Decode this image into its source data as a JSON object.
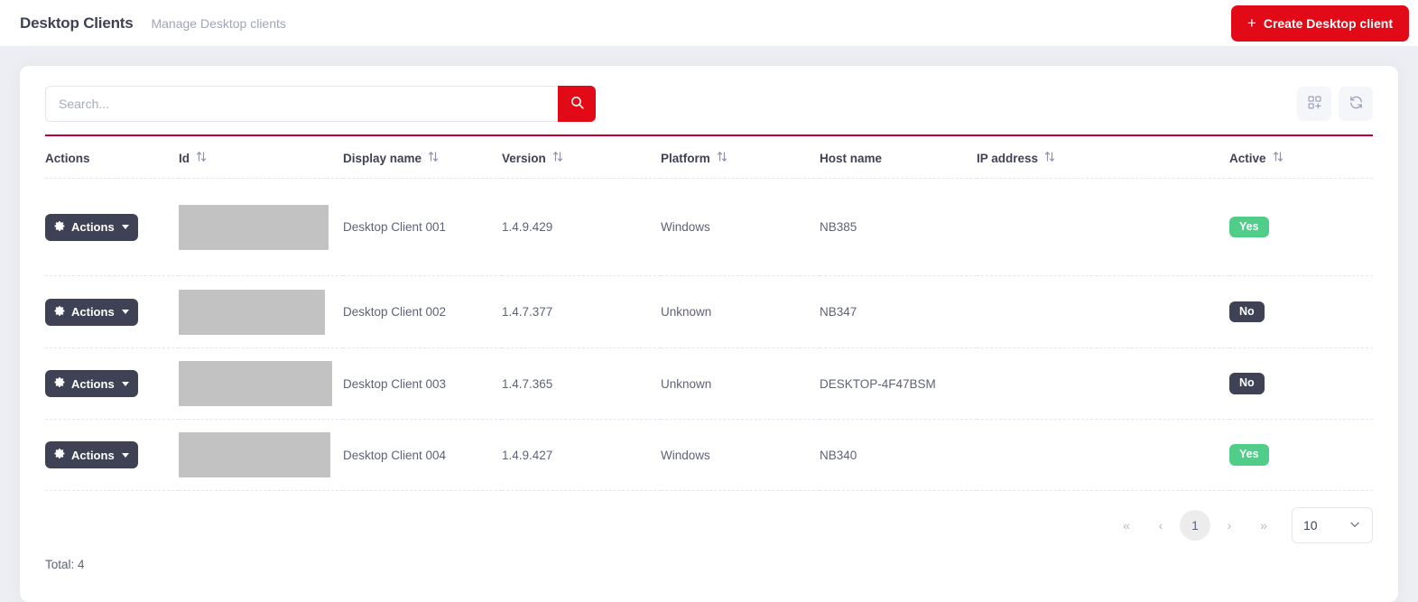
{
  "header": {
    "title": "Desktop Clients",
    "subtitle": "Manage Desktop clients",
    "create_button": "Create Desktop client",
    "create_button_plus": "+"
  },
  "toolbar": {
    "search_placeholder": "Search...",
    "search_value": "",
    "search_icon": "search-icon",
    "columns_icon": "grid-add-icon",
    "refresh_icon": "refresh-icon"
  },
  "table": {
    "columns": [
      {
        "label": "Actions",
        "sortable": false
      },
      {
        "label": "Id",
        "sortable": true
      },
      {
        "label": "Display name",
        "sortable": true
      },
      {
        "label": "Version",
        "sortable": true
      },
      {
        "label": "Platform",
        "sortable": true
      },
      {
        "label": "Host name",
        "sortable": false
      },
      {
        "label": "IP address",
        "sortable": true
      },
      {
        "label": "Active",
        "sortable": true
      }
    ],
    "action_label": "Actions",
    "rows": [
      {
        "id": "",
        "display_name": "Desktop Client 001",
        "version": "1.4.9.429",
        "platform": "Windows",
        "host_name": "NB385",
        "ip_address": "",
        "active": "Yes"
      },
      {
        "id": "",
        "display_name": "Desktop Client 002",
        "version": "1.4.7.377",
        "platform": "Unknown",
        "host_name": "NB347",
        "ip_address": "",
        "active": "No"
      },
      {
        "id": "",
        "display_name": "Desktop Client 003",
        "version": "1.4.7.365",
        "platform": "Unknown",
        "host_name": "DESKTOP-4F47BSM",
        "ip_address": "",
        "active": "No"
      },
      {
        "id": "",
        "display_name": "Desktop Client 004",
        "version": "1.4.9.427",
        "platform": "Windows",
        "host_name": "NB340",
        "ip_address": "",
        "active": "Yes"
      }
    ]
  },
  "pagination": {
    "first": "«",
    "prev": "‹",
    "current_page": "1",
    "next": "›",
    "last": "»",
    "page_size": "10"
  },
  "footer": {
    "total": "Total: 4"
  },
  "colors": {
    "accent_red": "#e30a17",
    "rule_red": "#c2002f",
    "dark": "#3f4254",
    "success_green": "#50cd89",
    "page_bg": "#eceef3"
  }
}
